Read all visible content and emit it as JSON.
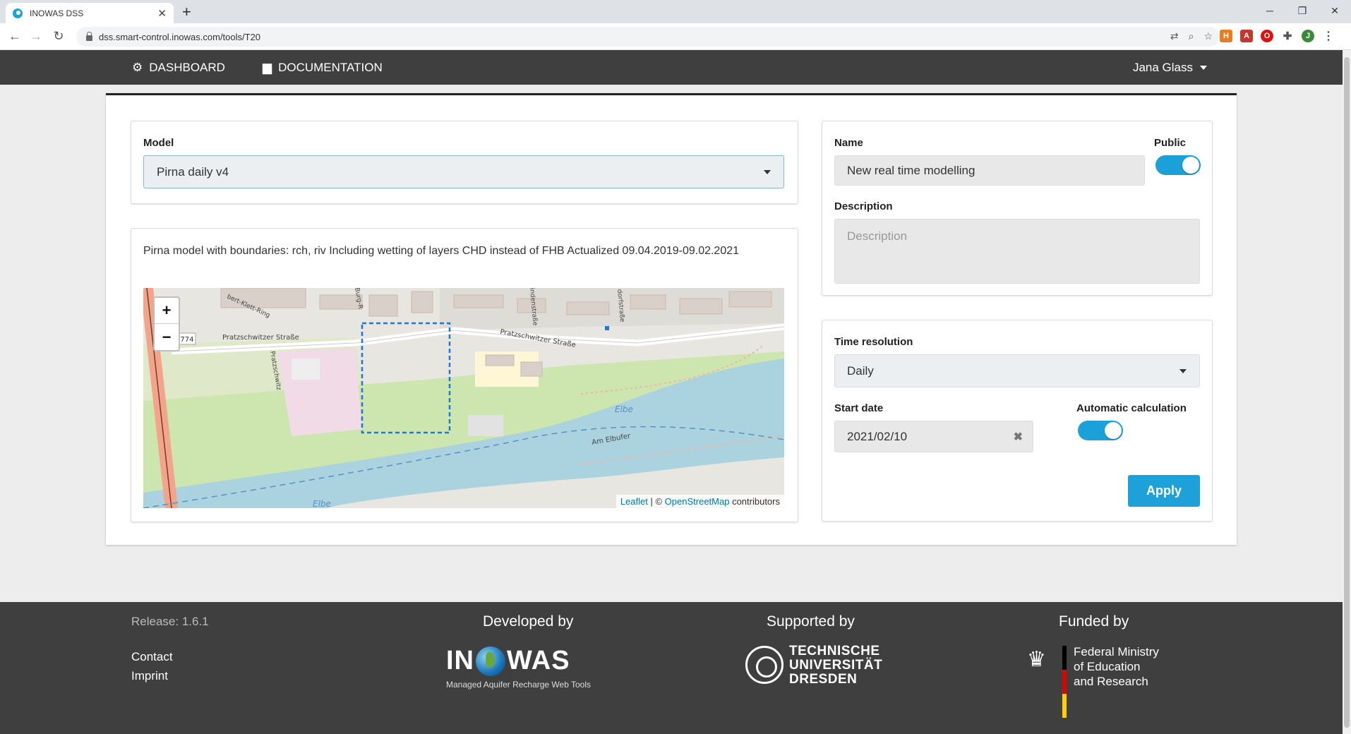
{
  "browser": {
    "tab_title": "INOWAS DSS",
    "tab_close": "✕",
    "new_tab": "+",
    "url": "dss.smart-control.inowas.com/tools/T20",
    "min": "─",
    "restore": "❐",
    "close": "✕"
  },
  "nav": {
    "dashboard": "DASHBOARD",
    "documentation": "DOCUMENTATION",
    "user": "Jana Glass"
  },
  "model": {
    "label": "Model",
    "selected": "Pirna daily v4",
    "description": "Pirna model with boundaries: rch, riv Including wetting of layers CHD instead of FHB Actualized 09.04.2019-09.02.2021"
  },
  "map": {
    "zoom_in": "+",
    "zoom_out": "−",
    "attribution_leaflet": "Leaflet",
    "attribution_sep": " | © ",
    "attribution_osm": "OpenStreetMap",
    "attribution_tail": " contributors",
    "street_1": "Pratzschwitzer Straße",
    "street_2": "Pratzschwitzer Straße",
    "street_3": "bert-Klett-Ring",
    "street_4": "Pratzschwitz",
    "street_5": "indenstraße",
    "street_6": "dorfstraße",
    "street_7": "Am Elbufer",
    "street_8": "Burg-R",
    "river_1": "Elbe",
    "river_2": "Elbe",
    "road_shield": "8774"
  },
  "settings": {
    "name_label": "Name",
    "name_value": "New real time modelling",
    "public_label": "Public",
    "description_label": "Description",
    "description_placeholder": "Description"
  },
  "time": {
    "resolution_label": "Time resolution",
    "resolution_value": "Daily",
    "start_label": "Start date",
    "start_value": "2021/02/10",
    "auto_label": "Automatic calculation",
    "apply": "Apply"
  },
  "footer": {
    "release": "Release: 1.6.1",
    "contact": "Contact",
    "imprint": "Imprint",
    "developed_by": "Developed by",
    "supported_by": "Supported by",
    "funded_by": "Funded by",
    "inowas_left": "IN",
    "inowas_right": "WAS",
    "inowas_sub": "Managed Aquifer Recharge Web Tools",
    "tud_line1": "TECHNISCHE",
    "tud_line2": "UNIVERSITÄT",
    "tud_line3": "DRESDEN",
    "bmbf_line1": "Federal Ministry",
    "bmbf_line2": "of Education",
    "bmbf_line3": "and Research"
  },
  "colors": {
    "accent": "#1da1d8",
    "nav_bg": "#3f3f3f",
    "water": "#aad3df",
    "green": "#cde6b0"
  }
}
